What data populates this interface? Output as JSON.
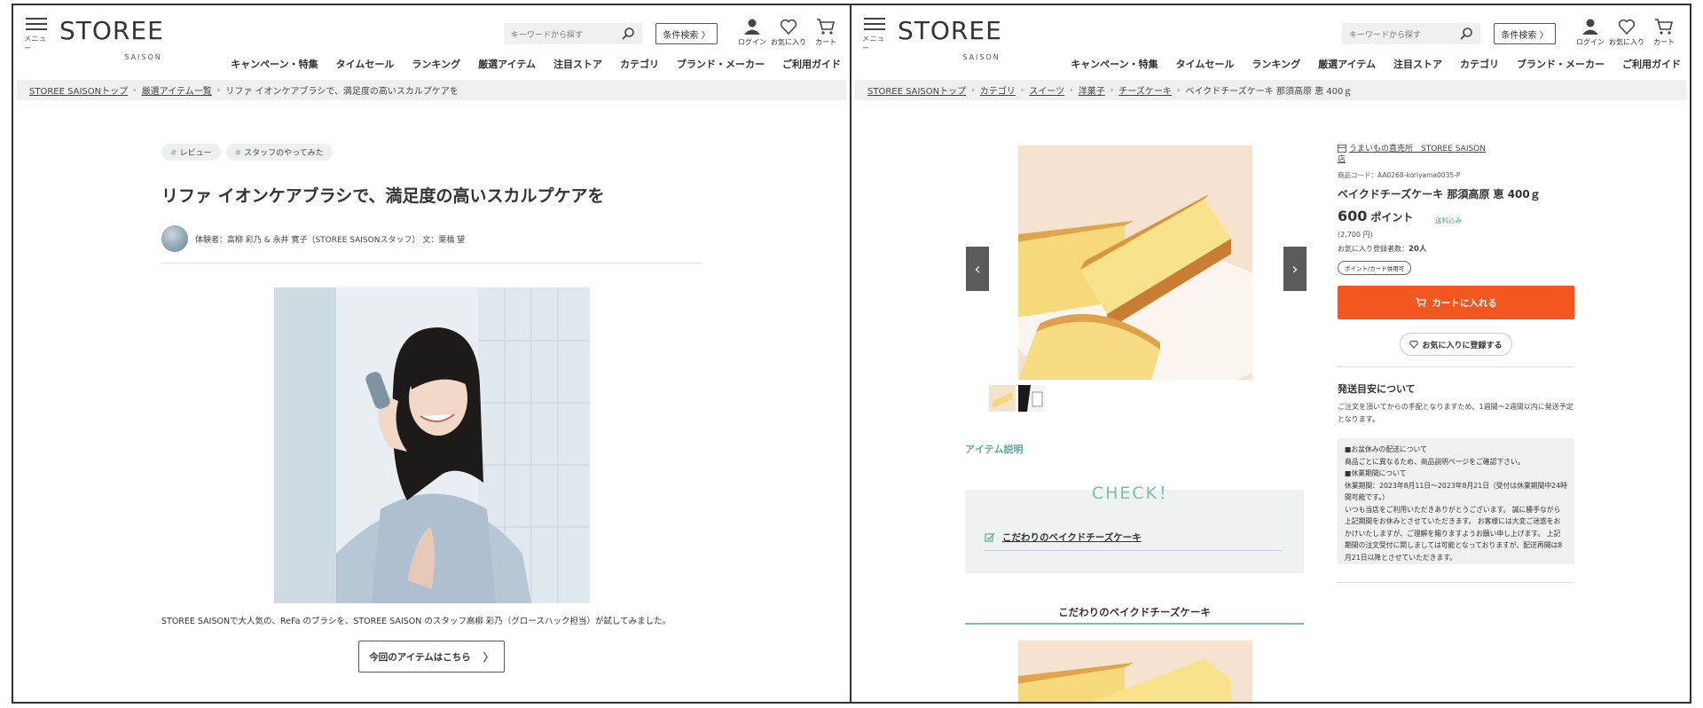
{
  "header": {
    "menu_label": "メニュー",
    "logo_main": "STOREE",
    "logo_sub": "SAISON",
    "search_placeholder": "キーワードから探す",
    "cond_search_label": "条件検索 〉",
    "login_label": "ログイン",
    "favorites_label": "お気に入り",
    "cart_label": "カート",
    "nav": [
      "キャンペーン・特集",
      "タイムセール",
      "ランキング",
      "厳選アイテム",
      "注目ストア",
      "カテゴリ",
      "ブランド・メーカー",
      "ご利用ガイド"
    ]
  },
  "left": {
    "breadcrumb": [
      "STOREE SAISONトップ",
      "厳選アイテム一覧",
      "リファ イオンケアブラシで、満足度の高いスカルプケアを"
    ],
    "tags": [
      "レビュー",
      "スタッフのやってみた"
    ],
    "title": "リファ イオンケアブラシで、満足度の高いスカルプケアを",
    "byline": "体験者：高柳 彩乃 & 永井 寛子（STOREE SAISONスタッフ） 文：栗橋 望",
    "caption": "STOREE SAISONで大人気の、ReFa のブラシを、STOREE SAISON のスタッフ高柳 彩乃（グロースハック担当）が試してみました。",
    "cta_label": "今回のアイテムはこちら"
  },
  "right": {
    "breadcrumb": [
      "STOREE SAISONトップ",
      "カテゴリ",
      "スイーツ",
      "洋菓子",
      "チーズケーキ",
      "ベイクドチーズケーキ 那須高原 恵 400ｇ"
    ],
    "shop_name_line1": "うまいもの直売所　STOREE SAISON",
    "shop_name_line2": "店",
    "product_code": "商品コード：AA0268-koriyama0035-P",
    "product_name": "ベイクドチーズケーキ 那須高原 恵 400ｇ",
    "price_value": "600",
    "price_unit": "ポイント",
    "price_tag": "送料込み",
    "yen": "(2,700 円)",
    "fav_count_label": "お気に入り登録者数：",
    "fav_count_value": "20人",
    "pay_badge": "ポイント/カード併用可",
    "cart_button": "カートに入れる",
    "fav_button": "お気に入りに登録する",
    "shipping_heading": "発送目安について",
    "shipping_text": "ご注文を頂いてからの手配となりますため、1週間～2週間以内に発送予定となります。",
    "notice_lines": [
      "■お盆休みの配送について",
      "商品ごとに異なるため、商品説明ページをご確認下さい。",
      "■休業期間について",
      "休業期間：2023年8月11日～2023年8月21日（受付は休業期間中24時間可能です。）",
      "いつも当店をご利用いただきありがとうございます。 誠に勝手ながら上記期間をお休みとさせていただきます。 お客様には大変ご迷惑をおかけいたしますが、ご理解を賜りますようお願い申し上げます。 上記期間の注文受付に関しましては可能となっておりますが、配送再開は8月21日以降とさせていただきます。"
    ],
    "section_label": "アイテム説明",
    "check_title": "CHECK！",
    "check_item": "こだわりのベイクドチーズケーキ",
    "sub_heading": "こだわりのベイクドチーズケーキ"
  }
}
